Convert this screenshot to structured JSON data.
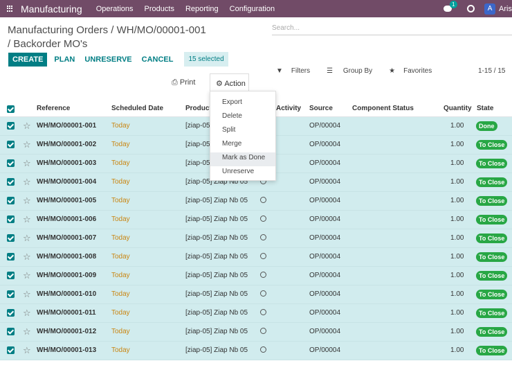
{
  "navbar": {
    "app_name": "Manufacturing",
    "menu": [
      "Operations",
      "Products",
      "Reporting",
      "Configuration"
    ],
    "chat_count": "1",
    "avatar_initial": "A",
    "username": "Aris"
  },
  "breadcrumb": {
    "parent": "Manufacturing Orders",
    "record": "WH/MO/00001-001",
    "current": "Backorder MO's"
  },
  "search": {
    "placeholder": "Search..."
  },
  "toolbar": {
    "create": "CREATE",
    "plan": "PLAN",
    "unreserve": "UNRESERVE",
    "cancel": "CANCEL",
    "selected": "15 selected",
    "print": "Print",
    "action": "Action"
  },
  "filters": {
    "filters": "Filters",
    "group_by": "Group By",
    "favorites": "Favorites"
  },
  "pager": "1-15 / 15",
  "action_menu": [
    "Export",
    "Delete",
    "Split",
    "Merge",
    "Mark as Done",
    "Unreserve"
  ],
  "columns": [
    "Reference",
    "Scheduled Date",
    "Product",
    "Activity",
    "Source",
    "Component Status",
    "Quantity",
    "State"
  ],
  "rows": [
    {
      "ref": "WH/MO/00001-001",
      "date": "Today",
      "product": "[ziap-05]",
      "source": "OP/00004",
      "qty": "1.00",
      "state": "Done"
    },
    {
      "ref": "WH/MO/00001-002",
      "date": "Today",
      "product": "[ziap-05]",
      "source": "OP/00004",
      "qty": "1.00",
      "state": "To Close"
    },
    {
      "ref": "WH/MO/00001-003",
      "date": "Today",
      "product": "[ziap-05]",
      "source": "OP/00004",
      "qty": "1.00",
      "state": "To Close"
    },
    {
      "ref": "WH/MO/00001-004",
      "date": "Today",
      "product": "[ziap-05] Ziap Nb 05",
      "source": "OP/00004",
      "qty": "1.00",
      "state": "To Close"
    },
    {
      "ref": "WH/MO/00001-005",
      "date": "Today",
      "product": "[ziap-05] Ziap Nb 05",
      "source": "OP/00004",
      "qty": "1.00",
      "state": "To Close"
    },
    {
      "ref": "WH/MO/00001-006",
      "date": "Today",
      "product": "[ziap-05] Ziap Nb 05",
      "source": "OP/00004",
      "qty": "1.00",
      "state": "To Close"
    },
    {
      "ref": "WH/MO/00001-007",
      "date": "Today",
      "product": "[ziap-05] Ziap Nb 05",
      "source": "OP/00004",
      "qty": "1.00",
      "state": "To Close"
    },
    {
      "ref": "WH/MO/00001-008",
      "date": "Today",
      "product": "[ziap-05] Ziap Nb 05",
      "source": "OP/00004",
      "qty": "1.00",
      "state": "To Close"
    },
    {
      "ref": "WH/MO/00001-009",
      "date": "Today",
      "product": "[ziap-05] Ziap Nb 05",
      "source": "OP/00004",
      "qty": "1.00",
      "state": "To Close"
    },
    {
      "ref": "WH/MO/00001-010",
      "date": "Today",
      "product": "[ziap-05] Ziap Nb 05",
      "source": "OP/00004",
      "qty": "1.00",
      "state": "To Close"
    },
    {
      "ref": "WH/MO/00001-011",
      "date": "Today",
      "product": "[ziap-05] Ziap Nb 05",
      "source": "OP/00004",
      "qty": "1.00",
      "state": "To Close"
    },
    {
      "ref": "WH/MO/00001-012",
      "date": "Today",
      "product": "[ziap-05] Ziap Nb 05",
      "source": "OP/00004",
      "qty": "1.00",
      "state": "To Close"
    },
    {
      "ref": "WH/MO/00001-013",
      "date": "Today",
      "product": "[ziap-05] Ziap Nb 05",
      "source": "OP/00004",
      "qty": "1.00",
      "state": "To Close"
    }
  ]
}
